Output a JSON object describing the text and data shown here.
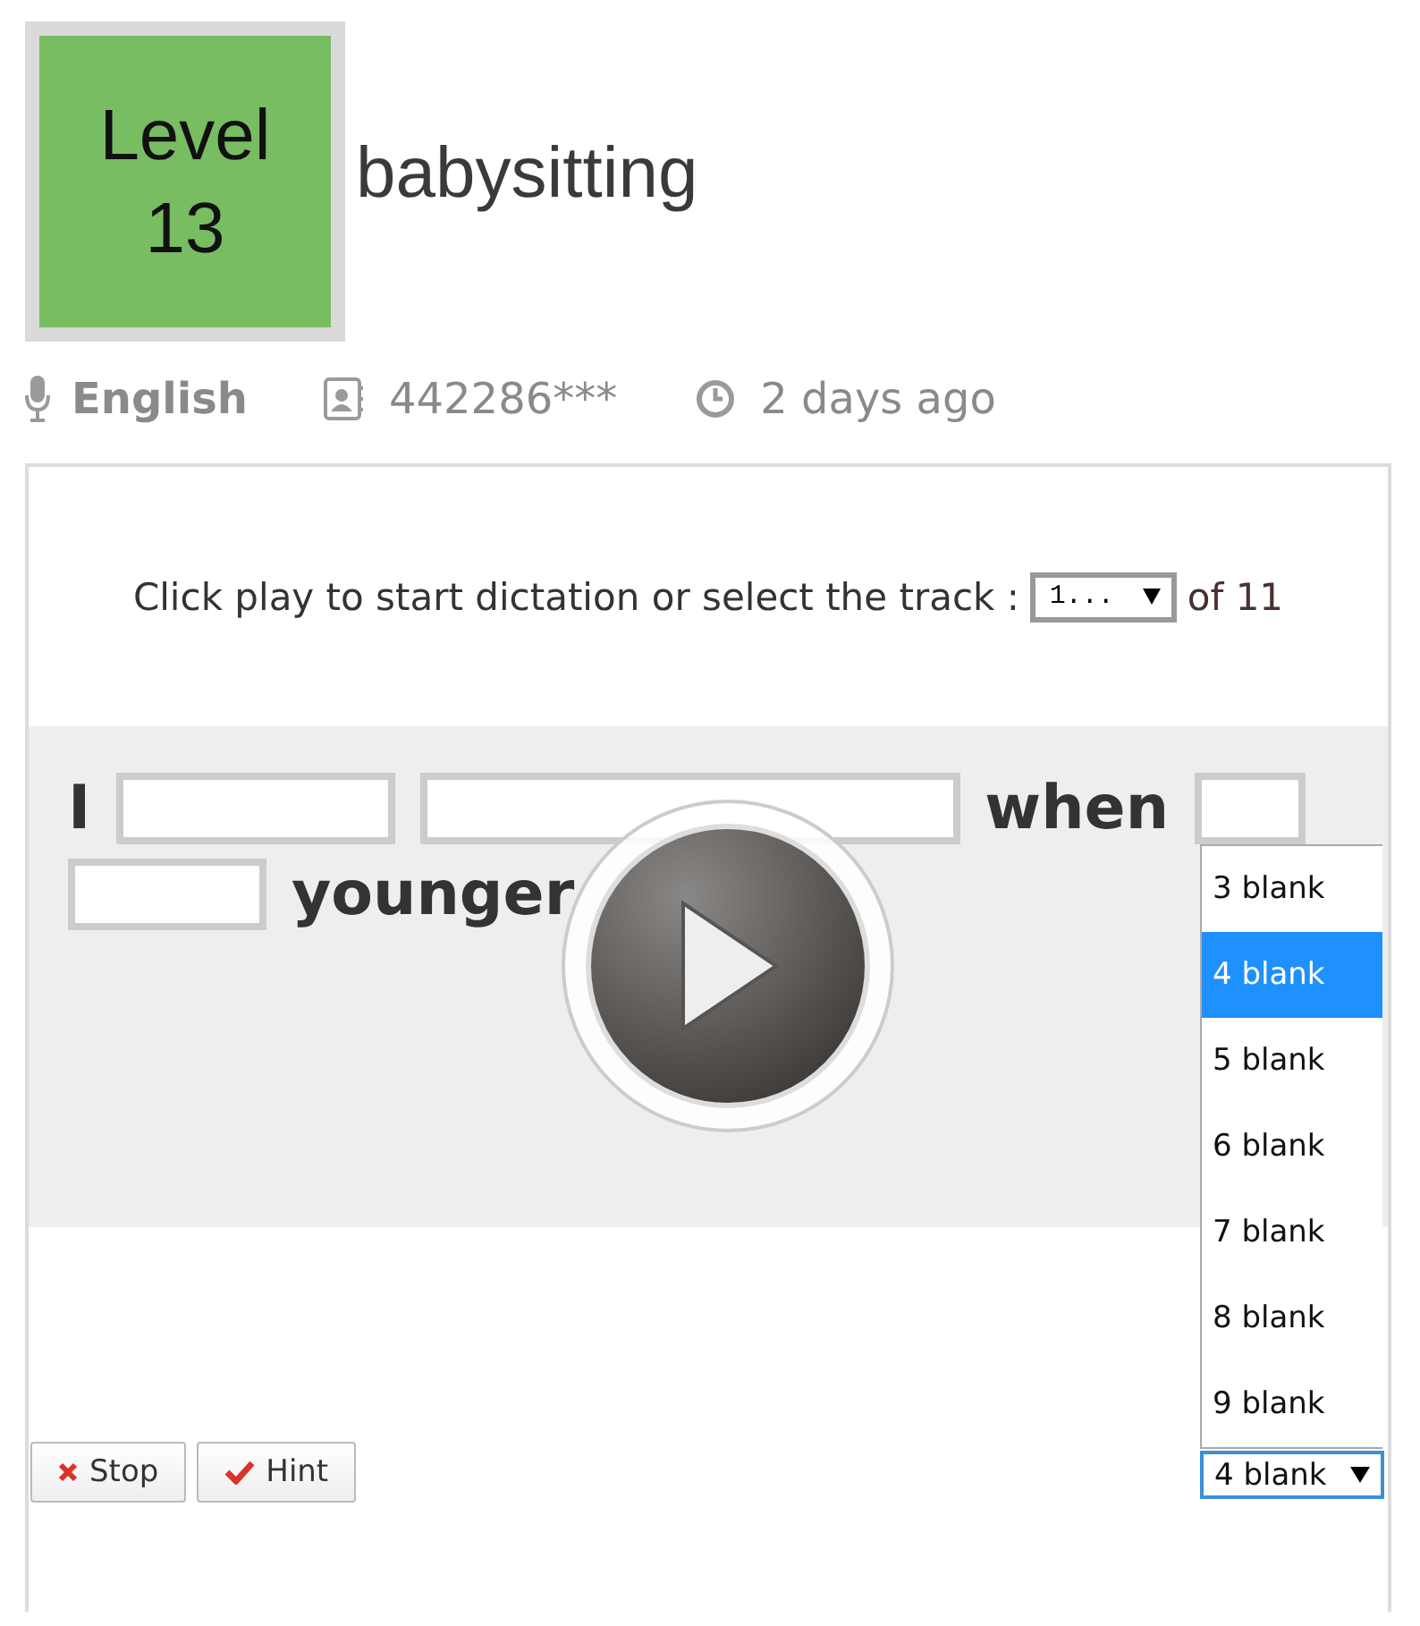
{
  "level_badge": {
    "label": "Level",
    "number": "13"
  },
  "title": "babysitting",
  "meta": {
    "language": "English",
    "user": "442286***",
    "time": "2 days ago"
  },
  "instruction": {
    "text": "Click play to start dictation or select the track :",
    "track_value": "1...",
    "track_total": "of 11"
  },
  "sentence": [
    {
      "kind": "word",
      "text": "I"
    },
    {
      "kind": "blank"
    },
    {
      "kind": "blank"
    },
    {
      "kind": "word",
      "text": "when"
    },
    {
      "kind": "blank"
    },
    {
      "kind": "blank"
    },
    {
      "kind": "word",
      "text": "younger"
    }
  ],
  "blank_dropdown": {
    "value": "4 blank",
    "options": [
      {
        "label": "3 blank",
        "selected": false
      },
      {
        "label": "4 blank",
        "selected": true
      },
      {
        "label": "5 blank",
        "selected": false
      },
      {
        "label": "6 blank",
        "selected": false
      },
      {
        "label": "7 blank",
        "selected": false
      },
      {
        "label": "8 blank",
        "selected": false
      },
      {
        "label": "9 blank",
        "selected": false
      }
    ]
  },
  "buttons": [
    {
      "kind": "stop",
      "label": "Stop"
    },
    {
      "kind": "hint",
      "label": "Hint"
    }
  ]
}
